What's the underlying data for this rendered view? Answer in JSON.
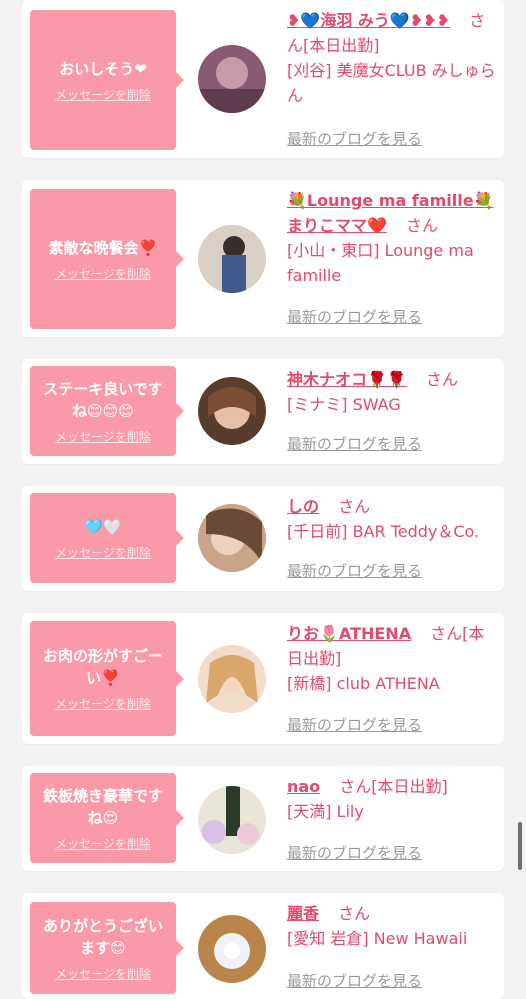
{
  "delete_label": "メッセージを削除",
  "blog_label": "最新のブログを見る",
  "san_label": "さん",
  "cards": [
    {
      "message": "おいしそう❤",
      "name": "❥💙海羽 みう💙❥❥❥",
      "name_suffix": "さん[本日出勤]",
      "shop": "[刈谷] 美魔女CLUB みしゅらん"
    },
    {
      "message": "素敵な晩餐会❣️",
      "name": "💐Lounge ma famille💐 まりこママ❤️",
      "name_suffix": "さん",
      "shop": "[小山・東口] Lounge ma famille"
    },
    {
      "message": "ステーキ良いですね😊😊😊",
      "name": "神木ナオコ🌹🌹",
      "name_suffix": "さん",
      "shop": "[ミナミ] SWAG"
    },
    {
      "message": "🩵🤍",
      "name": "しの",
      "name_suffix": "さん",
      "shop": "[千日前] BAR Teddy＆Co."
    },
    {
      "message": "お肉の形がすごーい❣️",
      "name": "りお🌷ATHENA",
      "name_suffix": "さん[本日出勤]",
      "shop": "[新橋] club ATHENA"
    },
    {
      "message": "鉄板焼き豪華ですね😍",
      "name": "nao",
      "name_suffix": "さん[本日出勤]",
      "shop": "[天満] Lily"
    },
    {
      "message": "ありがとうございます😊",
      "name": "麗香",
      "name_suffix": "さん",
      "shop": "[愛知 岩倉] New Hawaii"
    }
  ],
  "colors": {
    "accent": "#e24b6d",
    "bubble": "#fa9aa9",
    "background": "#f2f2f2"
  }
}
